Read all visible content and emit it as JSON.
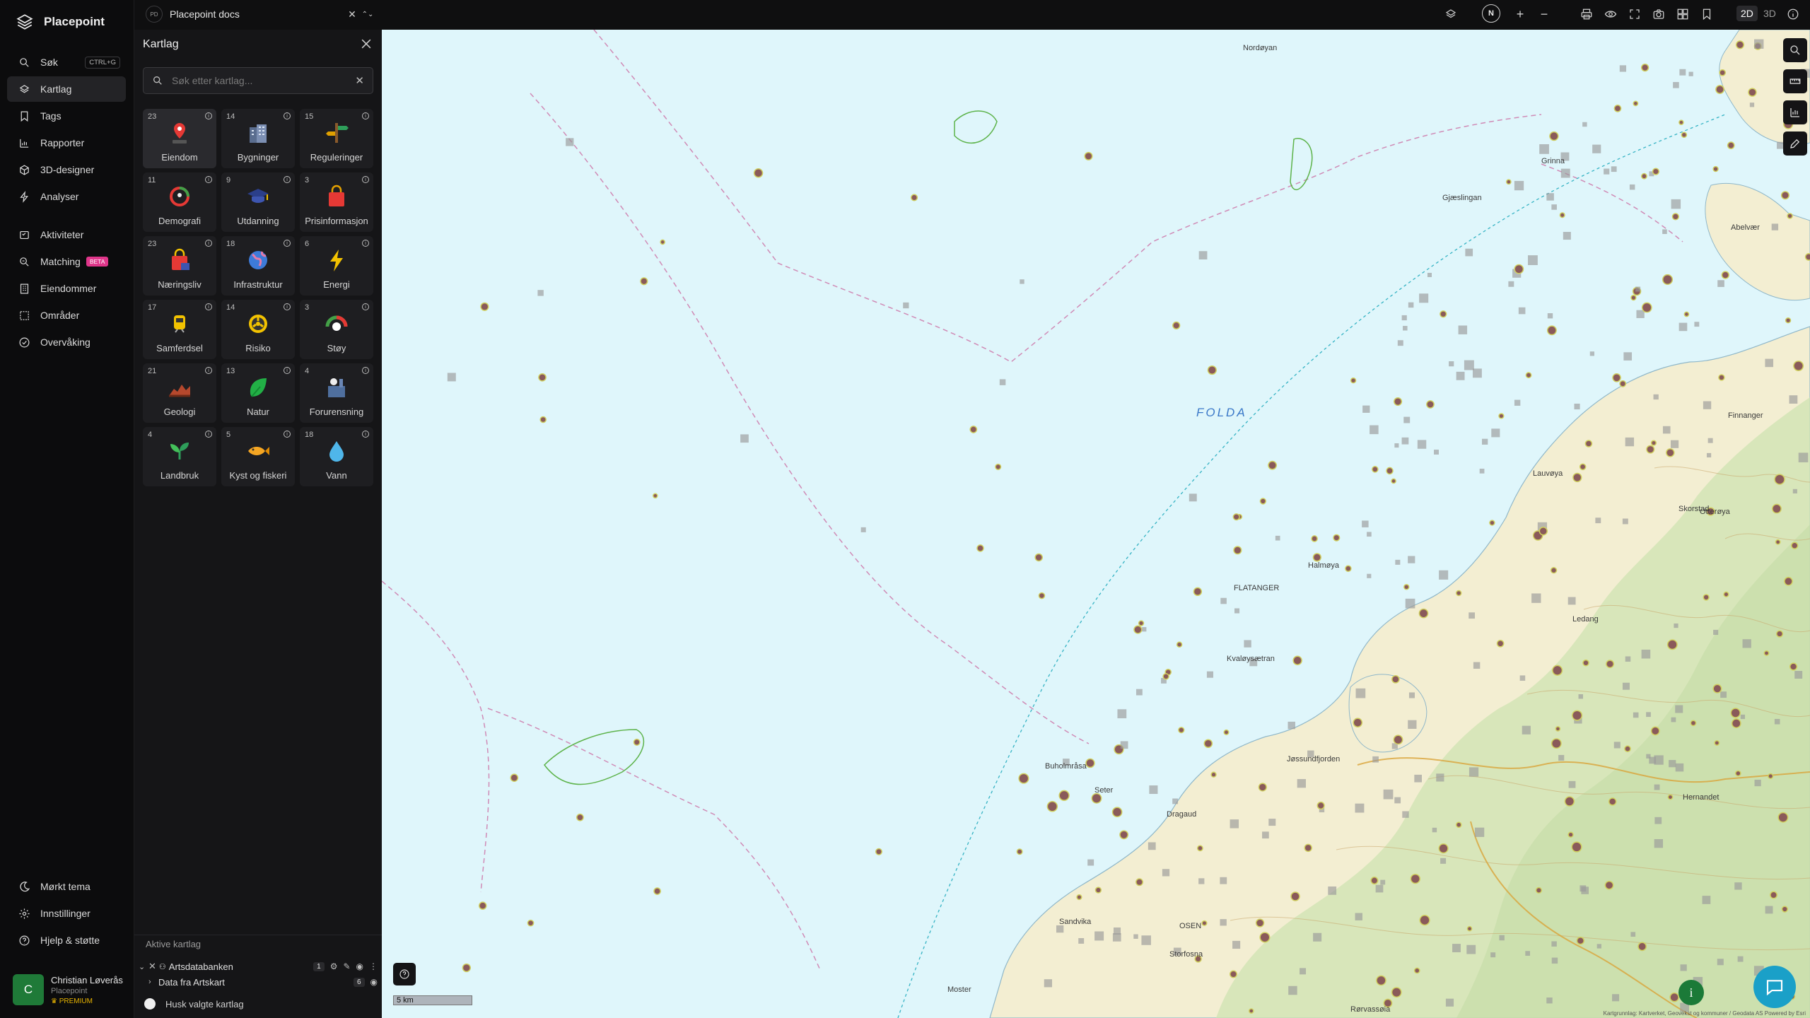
{
  "app": {
    "name": "Placepoint"
  },
  "nav": {
    "items": [
      {
        "label": "Søk",
        "icon": "search-icon",
        "shortcut": "CTRL+G"
      },
      {
        "label": "Kartlag",
        "icon": "layers-icon",
        "active": true
      },
      {
        "label": "Tags",
        "icon": "bookmark-icon"
      },
      {
        "label": "Rapporter",
        "icon": "bar-chart-icon"
      },
      {
        "label": "3D-designer",
        "icon": "cube-icon"
      },
      {
        "label": "Analyser",
        "icon": "lightning-icon"
      },
      {
        "label": "Aktiviteter",
        "icon": "activity-icon"
      },
      {
        "label": "Matching",
        "icon": "match-icon",
        "badge": "BETA"
      },
      {
        "label": "Eiendommer",
        "icon": "building-icon"
      },
      {
        "label": "Områder",
        "icon": "area-icon"
      },
      {
        "label": "Overvåking",
        "icon": "monitor-icon"
      }
    ],
    "bottom": [
      {
        "label": "Mørkt tema",
        "icon": "moon-icon"
      },
      {
        "label": "Innstillinger",
        "icon": "gear-icon"
      },
      {
        "label": "Hjelp & støtte",
        "icon": "help-icon"
      }
    ],
    "user": {
      "initial": "C",
      "name": "Christian Løverås",
      "org": "Placepoint",
      "tier": "PREMIUM"
    }
  },
  "topbar": {
    "doc_badge": "PD",
    "doc_title": "Placepoint docs",
    "north": "N",
    "mode_2d": "2D",
    "mode_3d": "3D",
    "active_mode": "2D"
  },
  "panel": {
    "title": "Kartlag",
    "search_placeholder": "Søk etter kartlag...",
    "categories": [
      {
        "label": "Eiendom",
        "count": "23",
        "icon": "property-pin-icon",
        "selected": true
      },
      {
        "label": "Bygninger",
        "count": "14",
        "icon": "buildings-icon"
      },
      {
        "label": "Reguleringer",
        "count": "15",
        "icon": "signpost-icon"
      },
      {
        "label": "Demografi",
        "count": "11",
        "icon": "demography-icon"
      },
      {
        "label": "Utdanning",
        "count": "9",
        "icon": "graduation-cap-icon"
      },
      {
        "label": "Prisinformasjon",
        "count": "3",
        "icon": "shopping-bag-icon"
      },
      {
        "label": "Næringsliv",
        "count": "23",
        "icon": "business-bag-icon"
      },
      {
        "label": "Infrastruktur",
        "count": "18",
        "icon": "globe-icon"
      },
      {
        "label": "Energi",
        "count": "6",
        "icon": "lightning-bolt-icon"
      },
      {
        "label": "Samferdsel",
        "count": "17",
        "icon": "train-icon"
      },
      {
        "label": "Risiko",
        "count": "14",
        "icon": "hazard-icon"
      },
      {
        "label": "Støy",
        "count": "3",
        "icon": "noise-gauge-icon"
      },
      {
        "label": "Geologi",
        "count": "21",
        "icon": "terrain-icon"
      },
      {
        "label": "Natur",
        "count": "13",
        "icon": "leaf-icon"
      },
      {
        "label": "Forurensning",
        "count": "4",
        "icon": "factory-icon"
      },
      {
        "label": "Landbruk",
        "count": "4",
        "icon": "sprout-icon"
      },
      {
        "label": "Kyst og fiskeri",
        "count": "5",
        "icon": "fish-icon"
      },
      {
        "label": "Vann",
        "count": "18",
        "icon": "water-drop-icon"
      }
    ],
    "active_header": "Aktive kartlag",
    "active_layers": [
      {
        "name": "Artsdatabanken",
        "count": "1",
        "expanded": true
      },
      {
        "name": "Data fra Artskart",
        "count": "6",
        "child": true
      }
    ],
    "remember_label": "Husk valgte kartlag"
  },
  "map": {
    "sea_label": "FOLDA",
    "places": [
      "Nordøyan",
      "Gjæslingan",
      "Grinna",
      "FLATANGER",
      "Halmøya",
      "Kvaløysætran",
      "Buholmråsa",
      "Seter",
      "Dragaud",
      "Jøssundfjorden",
      "Sandvika",
      "OSEN",
      "Storfosna",
      "Hernandet",
      "Otterøya",
      "Skorstad",
      "Lauvøya",
      "Moster",
      "Rørvassøia",
      "Abelvær",
      "Finnanger",
      "Ledang"
    ],
    "scale_label": "5 km",
    "attribution": "Kartgrunnlag: Kartverket, Geovekst og kommuner / Geodata AS Powered by Esri",
    "colors": {
      "sea": "#dff6fb",
      "land": "#f3eed2",
      "forest": "#cfe3b2",
      "contour": "#c9a56a",
      "markers": "#8a8a8a"
    }
  }
}
